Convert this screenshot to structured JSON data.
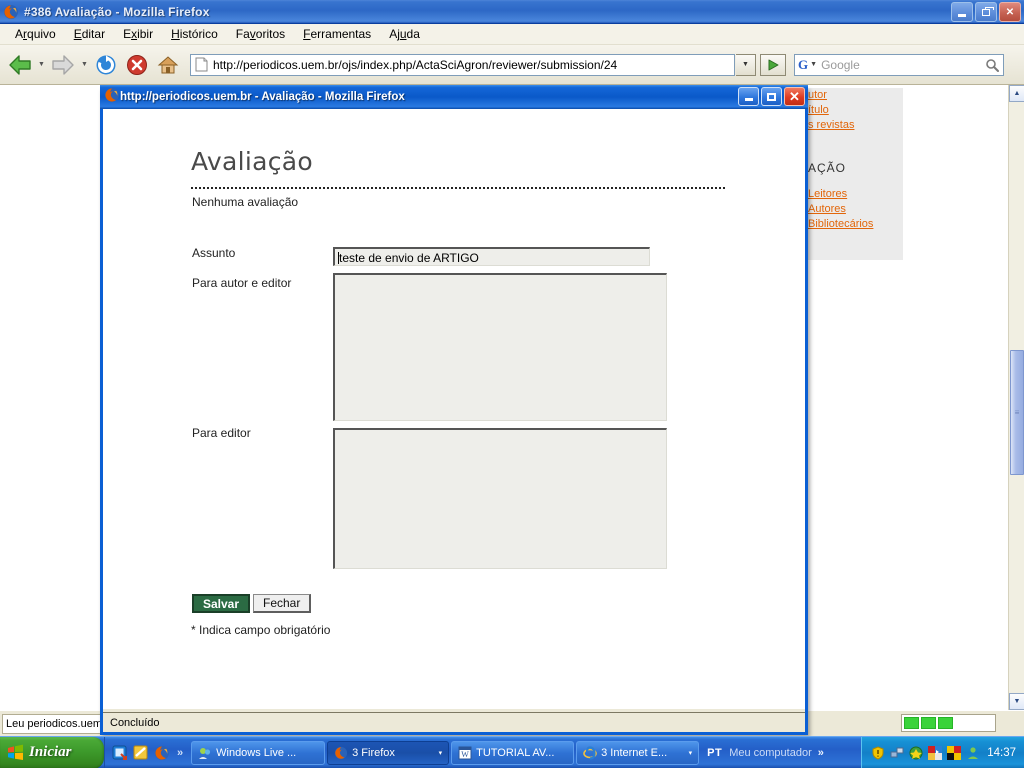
{
  "main_window": {
    "title": "#386 Avaliação - Mozilla Firefox",
    "favicon": "firefox-icon",
    "menus": [
      {
        "pre": "A",
        "key": "r",
        "post": "quivo"
      },
      {
        "pre": "",
        "key": "E",
        "post": "ditar"
      },
      {
        "pre": "E",
        "key": "x",
        "post": "ibir"
      },
      {
        "pre": "",
        "key": "H",
        "post": "istórico"
      },
      {
        "pre": "Fa",
        "key": "v",
        "post": "oritos"
      },
      {
        "pre": "",
        "key": "F",
        "post": "erramentas"
      },
      {
        "pre": "Aj",
        "key": "u",
        "post": "da"
      }
    ],
    "menu_labels": [
      "Arquivo",
      "Editar",
      "Exibir",
      "Histórico",
      "Favoritos",
      "Ferramentas",
      "Ajuda"
    ],
    "toolbar": {
      "back": "back-arrow-icon",
      "forward": "forward-arrow-icon",
      "reload": "reload-icon",
      "stop": "stop-icon",
      "home": "home-icon",
      "url": "http://periodicos.uem.br/ojs/index.php/ActaSciAgron/reviewer/submission/24",
      "go": "go-arrow-icon",
      "search_engine": "Google",
      "search_placeholder": "Google"
    },
    "window_buttons": {
      "minimize": "minimize-icon",
      "restore": "restore-icon",
      "close": "close-icon"
    },
    "statusbar": {
      "text": "Leu periodicos.uem."
    },
    "progress_blocks": 3
  },
  "background_page": {
    "links_top": [
      "utor",
      "ítulo",
      "s revistas"
    ],
    "section_heading": "AÇÃO",
    "links_bottom": [
      "Leitores",
      "Autores",
      "Bibliotecários"
    ],
    "link_color": "#e2660a",
    "panel_color": "#ebebeb"
  },
  "popup_window": {
    "title": "http://periodicos.uem.br - Avaliação - Mozilla Firefox",
    "favicon": "firefox-icon",
    "window_buttons": {
      "minimize": "minimize-icon",
      "restore": "restore-icon",
      "close": "close-icon"
    },
    "statusbar": {
      "text": "Concluído"
    },
    "page": {
      "heading": "Avaliação",
      "no_review_text": "Nenhuma avaliação",
      "fields": [
        {
          "label": "Assunto",
          "value": "teste de envio de ARTIGO",
          "type": "text"
        },
        {
          "label": "Para autor e editor",
          "value": "",
          "type": "textarea"
        },
        {
          "label": "Para editor",
          "value": "",
          "type": "textarea"
        }
      ],
      "buttons": {
        "save": "Salvar",
        "close": "Fechar"
      },
      "required_note": "* Indica campo obrigatório"
    }
  },
  "taskbar": {
    "start_label": "Iniciar",
    "quick_launch": [
      "show-desktop-icon",
      "notes-icon",
      "firefox-icon"
    ],
    "quick_launch_more": "»",
    "tasks": [
      {
        "label": "Windows Live ...",
        "icon": "messenger-icon",
        "active": false,
        "caret": ""
      },
      {
        "label": "3 Firefox",
        "icon": "firefox-icon",
        "active": true,
        "caret": "▾"
      },
      {
        "label": "TUTORIAL AV...",
        "icon": "word-icon",
        "active": false,
        "caret": ""
      },
      {
        "label": "3 Internet E...",
        "icon": "ie-icon",
        "active": false,
        "caret": "▾"
      }
    ],
    "language": "PT",
    "desktop_toolbar_label": "Meu computador",
    "overflow_chevron": "»",
    "tray_icons": [
      "security-shield-icon",
      "network-icon",
      "firewall-icon",
      "color-icon-1",
      "color-icon-2",
      "user-icon"
    ],
    "clock": "14:37"
  }
}
